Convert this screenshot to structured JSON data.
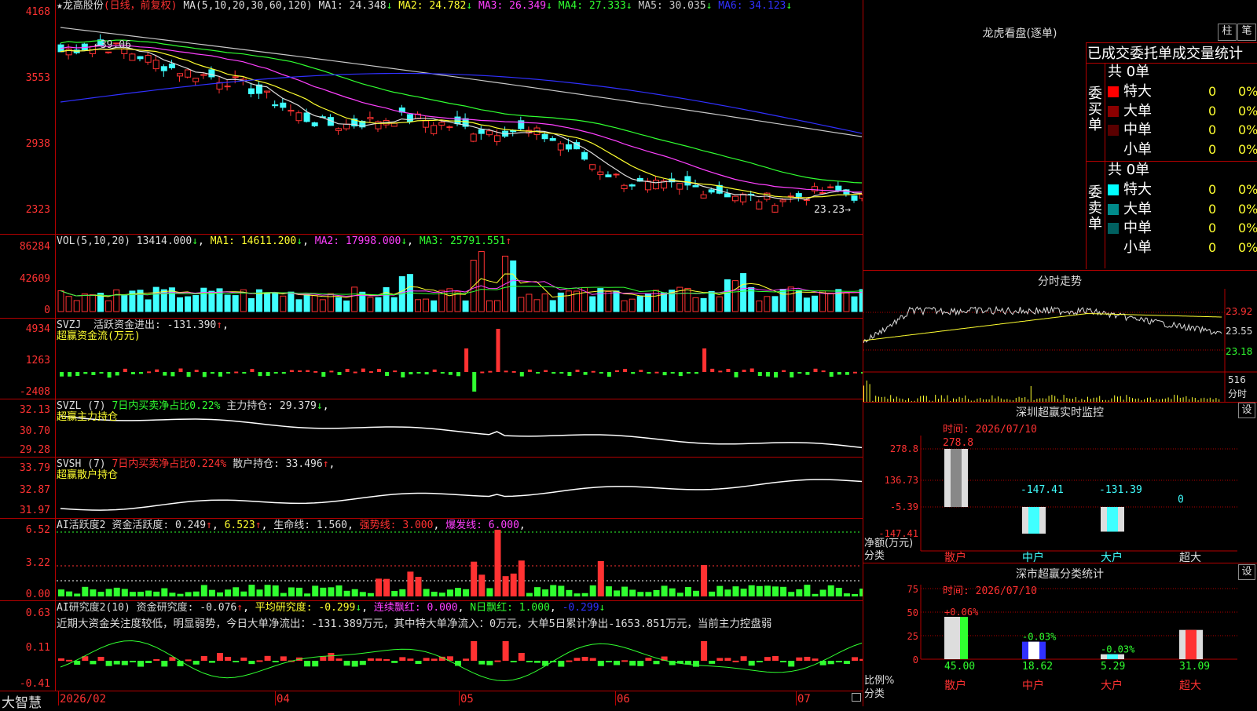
{
  "main_chart": {
    "stock_label": "★龙高股份",
    "period_label": "(日线，前复权)",
    "ma_params": "MA(5,10,20,30,60,120)",
    "ma": [
      {
        "label": "MA1:",
        "value": "24.348",
        "arrow": "↓",
        "color": "#dddddd"
      },
      {
        "label": "MA2:",
        "value": "24.782",
        "arrow": "↓",
        "color": "#ffff30"
      },
      {
        "label": "MA3:",
        "value": "26.349",
        "arrow": "↓",
        "color": "#ff40ff"
      },
      {
        "label": "MA4:",
        "value": "27.333",
        "arrow": "↓",
        "color": "#30ff30"
      },
      {
        "label": "MA5:",
        "value": "30.035",
        "arrow": "↓",
        "color": "#c8c8c8"
      },
      {
        "label": "MA6:",
        "value": "34.123",
        "arrow": "↓",
        "color": "#3030ff"
      }
    ],
    "y_ticks": [
      "4168",
      "3553",
      "2938",
      "2323"
    ],
    "high_marker": "39.06",
    "low_marker": "23.23"
  },
  "vol_panel": {
    "params": "VOL(5,10,20)",
    "value": "13414.000",
    "ma1": "MA1: 14611.200",
    "ma2": "MA2: 17998.000",
    "ma3": "MA3: 25791.551",
    "y_ticks": [
      "86284",
      "42609",
      "0"
    ]
  },
  "svzj_panel": {
    "name": "SVZJ",
    "desc": "活跃资金进出: -131.390",
    "sub": "超赢资金流(万元)",
    "y_ticks": [
      "4934",
      "1263",
      "-2408"
    ]
  },
  "svzl_panel": {
    "name": "SVZL (7)",
    "desc": "7日内买卖净占比0.22%",
    "desc2": "主力持仓: 29.379",
    "sub": "超赢主力持仓",
    "y_ticks": [
      "32.13",
      "30.70",
      "29.28"
    ]
  },
  "svsh_panel": {
    "name": "SVSH (7)",
    "desc": "7日内买卖净占比0.224%",
    "desc2": "散户持仓: 33.496",
    "sub": "超赢散户持仓",
    "y_ticks": [
      "33.79",
      "32.87",
      "31.97"
    ]
  },
  "ai_active_panel": {
    "name": "AI活跃度2",
    "v1": "资金活跃度: 0.249",
    "v2": "6.523",
    "v3": "生命线: 1.560",
    "v4": "强势线: 3.000",
    "v5": "爆发线: 6.000",
    "y_ticks": [
      "6.52",
      "3.22",
      "0.00"
    ]
  },
  "ai_research_panel": {
    "name": "AI研究度2(10)",
    "v1": "资金研究度: -0.076",
    "v2": "平均研究度: -0.299",
    "v3": "连续飘红: 0.000",
    "v4": "N日飘红: 1.000",
    "v5": "-0.299",
    "note": "近期大资金关注度较低，明显弱势，今日大单净流出：-131.389万元，其中特大单净流入：0万元，大单5日累计净出-1653.851万元，当前主力控盘弱",
    "y_ticks": [
      "0.63",
      "0.11",
      "-0.41"
    ]
  },
  "time_axis": {
    "brand": "大智慧",
    "labels": [
      "2026/02",
      "04",
      "05",
      "06",
      "07"
    ]
  },
  "right_panel": {
    "title": "龙虎看盘(逐单)",
    "btn_bar": "柱",
    "btn_pen": "笔",
    "order_title": "已成交委托单成交量统计",
    "buy_side": {
      "label": "委买单",
      "total": "共 0单",
      "rows": [
        {
          "name": "特大",
          "count": "0",
          "pct": "0%",
          "color": "#ff0000"
        },
        {
          "name": "大单",
          "count": "0",
          "pct": "0%",
          "color": "#8b0000"
        },
        {
          "name": "中单",
          "count": "0",
          "pct": "0%",
          "color": "#5a0000"
        },
        {
          "name": "小单",
          "count": "0",
          "pct": "0%",
          "color": "#000000"
        }
      ]
    },
    "sell_side": {
      "label": "委卖单",
      "total": "共 0单",
      "rows": [
        {
          "name": "特大",
          "count": "0",
          "pct": "0%",
          "color": "#00ffff"
        },
        {
          "name": "大单",
          "count": "0",
          "pct": "0%",
          "color": "#008b8b"
        },
        {
          "name": "中单",
          "count": "0",
          "pct": "0%",
          "color": "#006060"
        },
        {
          "name": "小单",
          "count": "0",
          "pct": "0%",
          "color": "#000000"
        }
      ]
    },
    "intraday": {
      "title": "分时走势",
      "prices": [
        "23.92",
        "23.55",
        "23.18"
      ],
      "vol_label": "516",
      "vol_unit": "分时"
    },
    "realtime_monitor": {
      "title": "深圳超赢实时监控",
      "btn": "设",
      "time": "时间: 2026/07/10",
      "y_ticks": [
        "278.8",
        "136.73",
        "-5.39",
        "-147.41"
      ],
      "bars": [
        {
          "cat": "散户",
          "value": "278.8"
        },
        {
          "cat": "中户",
          "value": "-147.41"
        },
        {
          "cat": "大户",
          "value": "-131.39"
        },
        {
          "cat": "超大",
          "value": "0"
        }
      ],
      "unit": "净额(万元)",
      "unit2": "分类"
    },
    "class_stats": {
      "title": "深市超赢分类统计",
      "btn": "设",
      "time": "时间: 2026/07/10",
      "y_ticks": [
        "75",
        "50",
        "25",
        "0"
      ],
      "bars": [
        {
          "cat": "散户",
          "pct": "+0.06%",
          "value": "45.00"
        },
        {
          "cat": "中户",
          "pct": "-0.03%",
          "value": "18.62"
        },
        {
          "cat": "大户",
          "pct": "-0.03%",
          "value": "5.29"
        },
        {
          "cat": "超大",
          "pct": "",
          "value": "31.09"
        }
      ],
      "unit": "比例%",
      "unit2": "分类"
    }
  }
}
